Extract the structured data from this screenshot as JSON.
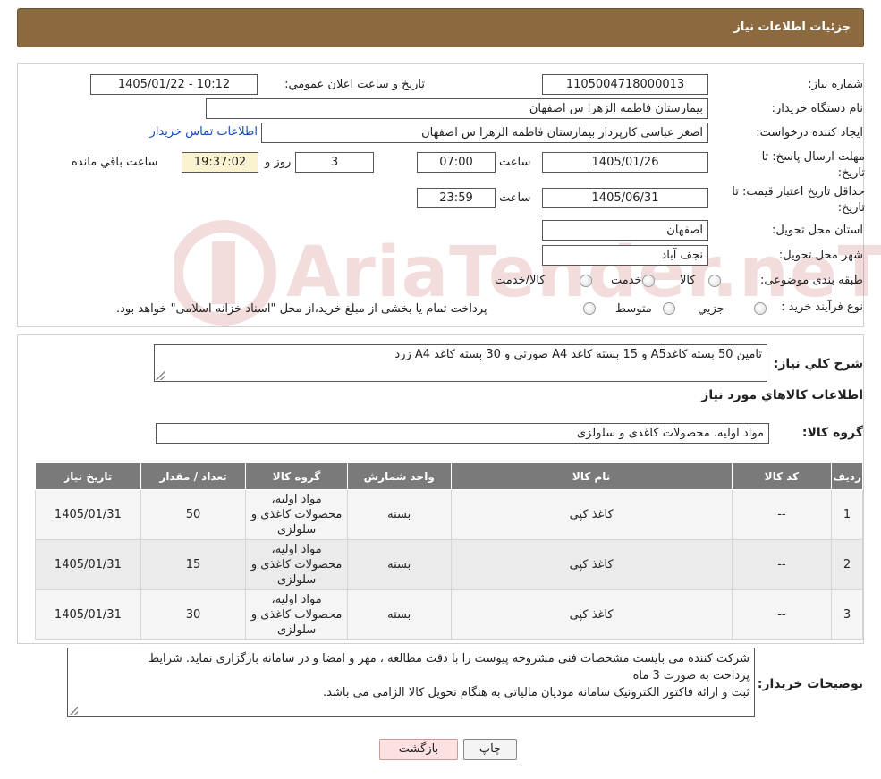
{
  "header": {
    "title": "جزئیات اطلاعات نیاز"
  },
  "form": {
    "need_number": {
      "label": "شماره نیاز:",
      "value": "1105004718000013"
    },
    "announce_datetime": {
      "label": "تاریخ و ساعت اعلان عمومي:",
      "value": "1405/01/22 - 10:12"
    },
    "buyer_org": {
      "label": "نام دستگاه خریدار:",
      "value": "بیمارستان فاطمه الزهرا س  اصفهان"
    },
    "requester": {
      "label": "ایجاد کننده درخواست:",
      "value": "اصغر عباسی کارپرداز بیمارستان فاطمه الزهرا س  اصفهان"
    },
    "contact_link": "اطلاعات تماس خریدار",
    "reply_deadline": {
      "label": "مهلت ارسال پاسخ: تا تاریخ:",
      "date": "1405/01/26",
      "time_label": "ساعت",
      "time": "07:00",
      "days": "3",
      "days_label": "روز و",
      "remaining": "19:37:02",
      "remaining_label": "ساعت باقي مانده"
    },
    "price_validity": {
      "label": "حداقل تاریخ اعتبار قیمت: تا تاریخ:",
      "date": "1405/06/31",
      "time_label": "ساعت",
      "time": "23:59"
    },
    "province": {
      "label": "استان محل تحویل:",
      "value": "اصفهان"
    },
    "city": {
      "label": "شهر محل تحویل:",
      "value": "نجف آباد"
    },
    "category": {
      "label": "طبقه بندی موضوعی:",
      "options": [
        "کالا",
        "خدمت",
        "کالا/خدمت"
      ]
    },
    "process_type": {
      "label": "نوع فرآیند خرید :",
      "options": [
        "جزیي",
        "متوسط"
      ],
      "note": "پرداخت تمام یا بخشی از مبلغ خرید،از محل \"اسناد خزانه اسلامی\" خواهد بود."
    }
  },
  "description": {
    "label": "شرح کلي نیاز:",
    "value": "تامین 50 بسته کاغذA5 و 15 بسته کاغذ A4 صورتی و 30 بسته کاغذ A4 زرد"
  },
  "goods_info_title": "اطلاعات کالاهاي مورد نیاز",
  "goods_group": {
    "label": "گروه کالا:",
    "value": "مواد اولیه، محصولات کاغذی و سلولزی"
  },
  "table": {
    "headers": [
      "ردیف",
      "کد کالا",
      "نام کالا",
      "واحد شمارش",
      "گروه کالا",
      "تعداد / مقدار",
      "تاریخ نیاز"
    ],
    "rows": [
      {
        "idx": "1",
        "code": "--",
        "name": "کاغذ کپی",
        "unit": "بسته",
        "group": "مواد اولیه، محصولات کاغذی و سلولزی",
        "qty": "50",
        "date": "1405/01/31"
      },
      {
        "idx": "2",
        "code": "--",
        "name": "کاغذ کپی",
        "unit": "بسته",
        "group": "مواد اولیه، محصولات کاغذی و سلولزی",
        "qty": "15",
        "date": "1405/01/31"
      },
      {
        "idx": "3",
        "code": "--",
        "name": "کاغذ کپی",
        "unit": "بسته",
        "group": "مواد اولیه، محصولات کاغذی و سلولزی",
        "qty": "30",
        "date": "1405/01/31"
      }
    ]
  },
  "buyer_notes": {
    "label": "توضیحات خریدار:",
    "lines": [
      "شرکت کننده می بایست مشخصات فنی مشروحه پیوست را با دقت مطالعه ، مهر و امضا و در سامانه بارگزاری نماید. شرایط",
      "پرداخت به صورت 3 ماه",
      "ثبت و ارائه فاکتور الکترونیک سامانه مودیان مالیاتی به هنگام تحویل کالا الزامی می باشد."
    ]
  },
  "buttons": {
    "print": "چاپ",
    "back": "بازگشت"
  },
  "watermark": {
    "text": "AriaTender.neT"
  }
}
